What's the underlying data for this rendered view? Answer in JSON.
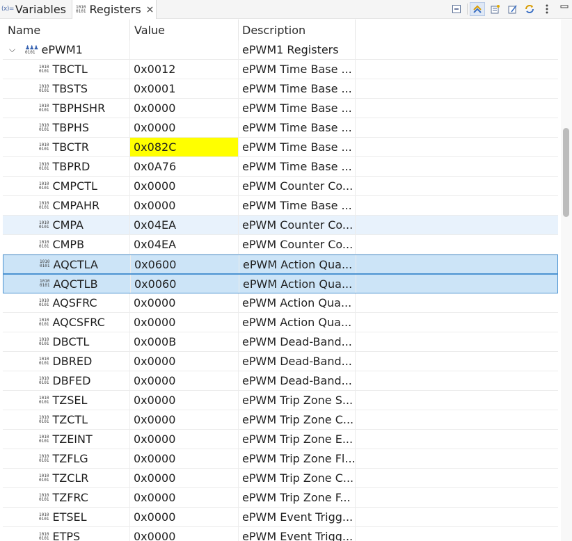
{
  "tabs": [
    {
      "label": "Variables",
      "icon": "variables-icon",
      "icon_text": "(x)="
    },
    {
      "label": "Registers",
      "icon": "registers-icon",
      "close": "×"
    }
  ],
  "register_bits": {
    "top": "1010",
    "bottom": "0101"
  },
  "toolbar": [
    {
      "name": "collapse-all-icon"
    },
    {
      "name": "link-with-debug-icon",
      "active": true
    },
    {
      "name": "new-group-icon"
    },
    {
      "name": "edit-group-icon"
    },
    {
      "name": "refresh-icon"
    },
    {
      "name": "view-menu-icon"
    },
    {
      "name": "minimize-icon"
    }
  ],
  "columns": {
    "name": "Name",
    "value": "Value",
    "description": "Description"
  },
  "group": {
    "twisty": "⌵",
    "name": "ePWM1",
    "description": "ePWM1 Registers"
  },
  "rows": [
    {
      "name": "TBCTL",
      "value": "0x0012",
      "description": "ePWM Time Base ..."
    },
    {
      "name": "TBSTS",
      "value": "0x0001",
      "description": "ePWM Time Base ..."
    },
    {
      "name": "TBPHSHR",
      "value": "0x0000",
      "description": "ePWM Time Base ..."
    },
    {
      "name": "TBPHS",
      "value": "0x0000",
      "description": "ePWM Time Base ..."
    },
    {
      "name": "TBCTR",
      "value": "0x082C",
      "description": "ePWM Time Base ...",
      "changed": true
    },
    {
      "name": "TBPRD",
      "value": "0x0A76",
      "description": "ePWM Time Base ..."
    },
    {
      "name": "CMPCTL",
      "value": "0x0000",
      "description": "ePWM Counter Co..."
    },
    {
      "name": "CMPAHR",
      "value": "0x0000",
      "description": "ePWM Time Base ..."
    },
    {
      "name": "CMPA",
      "value": "0x04EA",
      "description": "ePWM Counter Co...",
      "hover": true
    },
    {
      "name": "CMPB",
      "value": "0x04EA",
      "description": "ePWM Counter Co..."
    },
    {
      "name": "AQCTLA",
      "value": "0x0600",
      "description": "ePWM Action Qua...",
      "selected": true
    },
    {
      "name": "AQCTLB",
      "value": "0x0060",
      "description": "ePWM Action Qua...",
      "selected": true
    },
    {
      "name": "AQSFRC",
      "value": "0x0000",
      "description": "ePWM Action Qua..."
    },
    {
      "name": "AQCSFRC",
      "value": "0x0000",
      "description": "ePWM Action Qua..."
    },
    {
      "name": "DBCTL",
      "value": "0x000B",
      "description": "ePWM Dead-Band..."
    },
    {
      "name": "DBRED",
      "value": "0x0000",
      "description": "ePWM Dead-Band..."
    },
    {
      "name": "DBFED",
      "value": "0x0000",
      "description": "ePWM Dead-Band..."
    },
    {
      "name": "TZSEL",
      "value": "0x0000",
      "description": "ePWM Trip Zone S..."
    },
    {
      "name": "TZCTL",
      "value": "0x0000",
      "description": "ePWM Trip Zone C..."
    },
    {
      "name": "TZEINT",
      "value": "0x0000",
      "description": "ePWM Trip Zone E..."
    },
    {
      "name": "TZFLG",
      "value": "0x0000",
      "description": "ePWM Trip Zone Fl..."
    },
    {
      "name": "TZCLR",
      "value": "0x0000",
      "description": "ePWM Trip Zone C..."
    },
    {
      "name": "TZFRC",
      "value": "0x0000",
      "description": "ePWM Trip Zone F..."
    },
    {
      "name": "ETSEL",
      "value": "0x0000",
      "description": "ePWM Event Trigg..."
    },
    {
      "name": "ETPS",
      "value": "0x0000",
      "description": "ePWM Event Trigg..."
    }
  ],
  "colors": {
    "changed_value": "#ffff00",
    "selection": "#cce4f7",
    "selection_border": "#4c93d1",
    "hover": "#e8f2fc"
  }
}
